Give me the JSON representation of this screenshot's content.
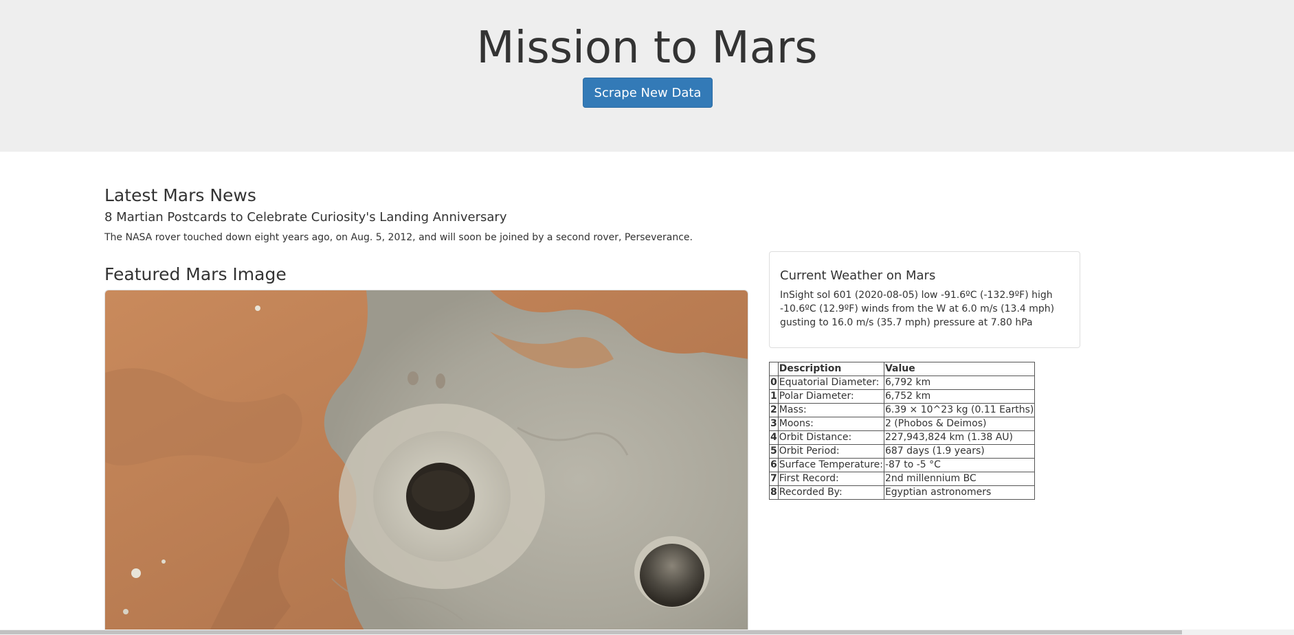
{
  "header": {
    "title": "Mission to Mars",
    "scrape_button_label": "Scrape New Data"
  },
  "news": {
    "heading": "Latest Mars News",
    "title": "8 Martian Postcards to Celebrate Curiosity's Landing Anniversary",
    "paragraph": "The NASA rover touched down eight years ago, on Aug. 5, 2012, and will soon be joined by a second rover, Perseverance."
  },
  "featured": {
    "heading": "Featured Mars Image"
  },
  "weather": {
    "heading": "Current Weather on Mars",
    "text": "InSight sol 601 (2020-08-05) low -91.6ºC (-132.9ºF) high -10.6ºC (12.9ºF) winds from the W at 6.0 m/s (13.4 mph) gusting to 16.0 m/s (35.7 mph) pressure at 7.80 hPa"
  },
  "facts": {
    "columns": [
      "",
      "Description",
      "Value"
    ],
    "rows": [
      {
        "index": "0",
        "description": "Equatorial Diameter:",
        "value": "6,792 km"
      },
      {
        "index": "1",
        "description": "Polar Diameter:",
        "value": "6,752 km"
      },
      {
        "index": "2",
        "description": "Mass:",
        "value": "6.39 × 10^23 kg (0.11 Earths)"
      },
      {
        "index": "3",
        "description": "Moons:",
        "value": "2 (Phobos & Deimos)"
      },
      {
        "index": "4",
        "description": "Orbit Distance:",
        "value": "227,943,824 km (1.38 AU)"
      },
      {
        "index": "5",
        "description": "Orbit Period:",
        "value": "687 days (1.9 years)"
      },
      {
        "index": "6",
        "description": "Surface Temperature:",
        "value": "-87 to -5 °C"
      },
      {
        "index": "7",
        "description": "First Record:",
        "value": "2nd millennium BC"
      },
      {
        "index": "8",
        "description": "Recorded By:",
        "value": "Egyptian astronomers"
      }
    ]
  },
  "colors": {
    "jumbotron_bg": "#eeeeee",
    "button_bg": "#337ab7",
    "text": "#333333"
  }
}
